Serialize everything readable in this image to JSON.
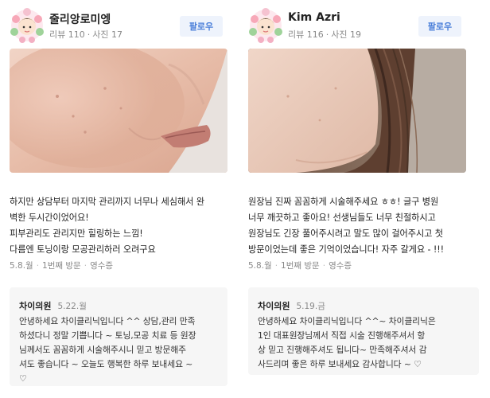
{
  "reviews": [
    {
      "nickname": "줄리앙로미엥",
      "review_count": "리뷰 110",
      "photo_count": "사진 17",
      "follow_label": "팔로우",
      "text": "하지만 상담부터 마지막 관리까지 너무나 세심해서 완\n벽한 두시간이었어요!\n피부관리도 관리지만 힐링하는 느낌!\n다름엔 토닝이랑 모공관리하러 오려구요",
      "visit_date": "5.8.월",
      "visit_count": "1번째 방문",
      "receipt": "영수증",
      "reply": {
        "owner": "차이의원",
        "date": "5.22.월",
        "text": "안녕하세요 차이클리닉입니다 ^^ 상담,관리 만족\n하셨다니 정말 기쁩니다 ~ 토닝,모공 치료 등 원장\n님께서도 꼼꼼하게 시술해주시니 믿고 방문해주\n셔도 좋습니다 ~ 오늘도 행복한 하루 보내세요 ~\n♡"
      }
    },
    {
      "nickname": "Kim Azri",
      "review_count": "리뷰 116",
      "photo_count": "사진 19",
      "follow_label": "팔로우",
      "text": "원장님 진짜 꼼꼼하게 시술해주세요 ㅎㅎ! 글구 병원\n너무 깨끗하고 좋아요! 선생님들도 너무 친절하시고\n원장님도 긴장 풀어주시려고 말도 많이 걸어주시고 첫\n방문이었는데 좋은 기억이었습니다! 자주 갈게요 - !!!",
      "visit_date": "5.8.월",
      "visit_count": "1번째 방문",
      "receipt": "영수증",
      "reply": {
        "owner": "차이의원",
        "date": "5.19.금",
        "text": "안녕하세요 차이클리닉입니다 ^^~ 차이클리닉은\n1인 대표원장님께서 직접 시술 진행해주셔서 항\n상 믿고 진행해주셔도 됩니다~ 만족해주셔서 감\n사드리며 좋은 하루 보내세요 감사합니다 ~ ♡"
      }
    }
  ]
}
